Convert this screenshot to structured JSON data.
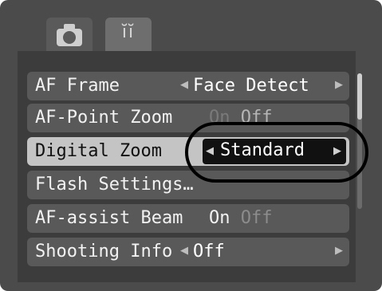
{
  "tabs": [
    {
      "icon": "camera-icon",
      "active": true
    },
    {
      "icon": "wrench-icon",
      "glyph": "ĭĭ",
      "active": false
    }
  ],
  "menu": {
    "items": [
      {
        "label": "AF Frame",
        "value": "Face Detect",
        "type": "arrows"
      },
      {
        "label": "AF-Point Zoom",
        "on": "On",
        "off": "Off",
        "type": "onoff",
        "selected_option": "Off"
      },
      {
        "label": "Digital Zoom",
        "value": "Standard",
        "type": "arrows",
        "selected": true
      },
      {
        "label": "Flash Settings…",
        "type": "submenu"
      },
      {
        "label": "AF-assist Beam",
        "on": "On",
        "off": "Off",
        "type": "onoff",
        "selected_option": "On"
      },
      {
        "label": "Shooting Info",
        "value": "Off",
        "type": "arrows"
      }
    ]
  },
  "colors": {
    "screen_bg": "#4b4b4b",
    "row_bg": "#595959",
    "row_selected_bg": "#c4c4c4",
    "value_box": "#111111",
    "highlight_ring": "#000000"
  }
}
